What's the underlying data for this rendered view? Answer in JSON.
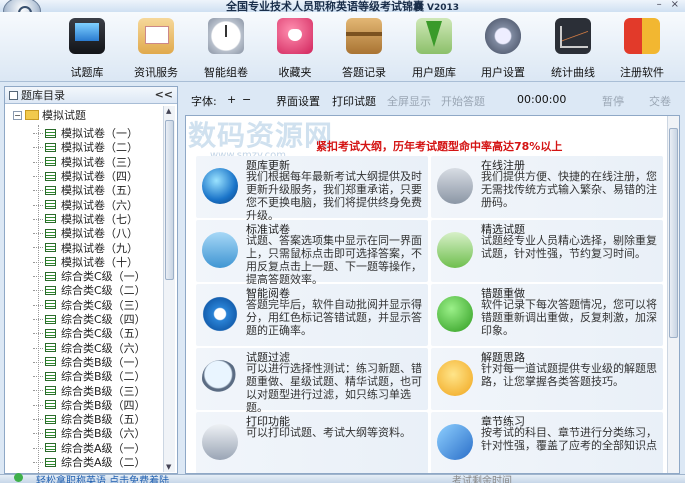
{
  "window": {
    "title": "全国专业技术人员职称英语等级考试锦囊",
    "version": "V2013",
    "minimize": "–",
    "close": "×"
  },
  "toolbar": [
    {
      "label": "试题库",
      "icon": "monitor-icon"
    },
    {
      "label": "资讯服务",
      "icon": "newspaper-icon"
    },
    {
      "label": "智能组卷",
      "icon": "clock-icon"
    },
    {
      "label": "收藏夹",
      "icon": "heart-icon"
    },
    {
      "label": "答题记录",
      "icon": "box-icon"
    },
    {
      "label": "用户题库",
      "icon": "download-icon"
    },
    {
      "label": "用户设置",
      "icon": "gear-icon"
    },
    {
      "label": "统计曲线",
      "icon": "chart-icon"
    },
    {
      "label": "注册软件",
      "icon": "shield-icon"
    }
  ],
  "sidebar": {
    "header": "题库目录",
    "collapse": "<<",
    "root": "模拟试题",
    "items": [
      "模拟试卷（一）",
      "模拟试卷（二）",
      "模拟试卷（三）",
      "模拟试卷（四）",
      "模拟试卷（五）",
      "模拟试卷（六）",
      "模拟试卷（七）",
      "模拟试卷（八）",
      "模拟试卷（九）",
      "模拟试卷（十）",
      "综合类C级（一）",
      "综合类C级（二）",
      "综合类C级（三）",
      "综合类C级（四）",
      "综合类C级（五）",
      "综合类C级（六）",
      "综合类B级（一）",
      "综合类B级（二）",
      "综合类B级（三）",
      "综合类B级（四）",
      "综合类B级（五）",
      "综合类B级（六）",
      "综合类A级（一）",
      "综合类A级（二）"
    ]
  },
  "main_toolbar": {
    "font_label": "字体:",
    "font_plus": "+",
    "font_minus": "−",
    "ui_settings": "界面设置",
    "print_exam": "打印试题",
    "fullscreen": "全屏显示",
    "start_answer": "开始答题",
    "timer": "00:00:00",
    "pause": "暂停",
    "submit": "交卷"
  },
  "content": {
    "watermark": "数码资源网",
    "watermark_url": "www.smzy.com",
    "banner": "紧扣考试大纲，历年考试题型命中率高达78%以上",
    "features": [
      {
        "title": "题库更新",
        "desc": "我们根据每年最新考试大纲提供及时更新升级服务，我们郑重承诺，只要您不更换电脑，我们将提供终身免费升级。",
        "icon": "globe-icon"
      },
      {
        "title": "在线注册",
        "desc": "我们提供方便、快捷的在线注册，您无需找传统方式输入繁杂、易错的注册码。",
        "icon": "database-icon"
      },
      {
        "title": "标准试卷",
        "desc": "试题、答案选项集中显示在同一界面上，只需鼠标点击即可选择答案，不用反复点击上一题、下一题等操作，提高答题效率。",
        "icon": "chat-icon"
      },
      {
        "title": "精选试题",
        "desc": "试题经专业人员精心选择，剔除重复试题，针对性强，节约复习时间。",
        "icon": "select-icon"
      },
      {
        "title": "智能阅卷",
        "desc": "答题完毕后，软件自动批阅并显示得分，用红色标记答错试题，并显示答题的正确率。",
        "icon": "cog-icon"
      },
      {
        "title": "错题重做",
        "desc": "软件记录下每次答题情况，您可以将错题重新调出重做，反复刺激，加深印象。",
        "icon": "plus-icon"
      },
      {
        "title": "试题过滤",
        "desc": "可以进行选择性测试：练习新题、错题重做、星级试题、精华试题，也可以对题型进行过滤，如只练习单选题。",
        "icon": "magnifier-icon"
      },
      {
        "title": "解题思路",
        "desc": "针对每一道试题提供专业级的解题思路，让您掌握各类答题技巧。",
        "icon": "bulb-icon"
      },
      {
        "title": "打印功能",
        "desc": "可以打印试题、考试大纲等资料。",
        "icon": "printer-icon"
      },
      {
        "title": "章节练习",
        "desc": "按考试的科目、章节进行分类练习，针对性强，覆盖了应考的全部知识点",
        "icon": "book-icon"
      }
    ]
  },
  "status": {
    "left": "轻松拿职称英语 点击免费着陆",
    "right": "考试剩余时间"
  }
}
